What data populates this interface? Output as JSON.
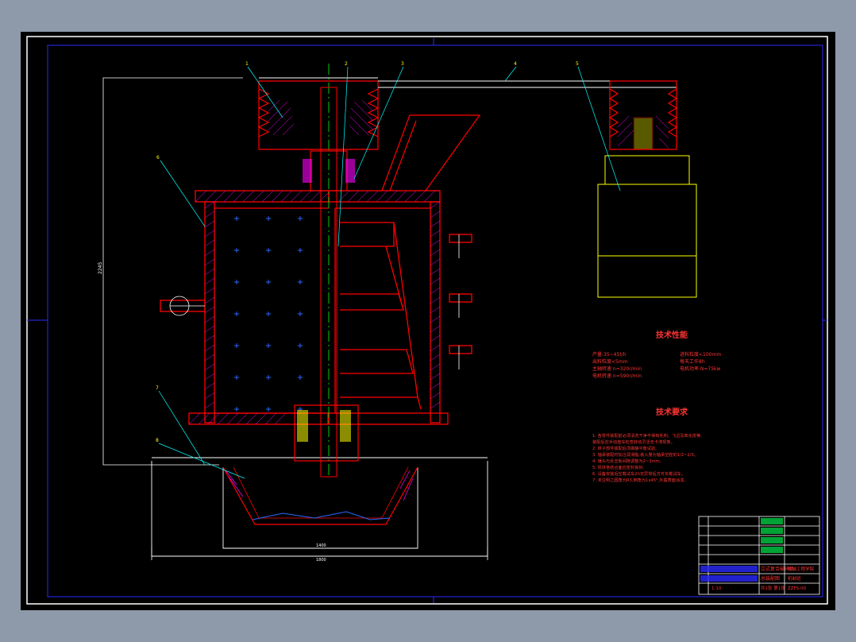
{
  "drawing": {
    "colors": {
      "background": "#000000",
      "chrome": "#8e9aaa",
      "frame": "#2a2aff",
      "outline": "#ff0000",
      "hatch": "#ff00ff",
      "centerline": "#00ff00",
      "leader": "#00ffff",
      "white": "#ffffff",
      "yellow": "#ffff00",
      "text": "#ff3333"
    }
  },
  "balloons": [
    "1",
    "2",
    "3",
    "4",
    "5",
    "6",
    "7",
    "8"
  ],
  "dimensions": {
    "overall_height": "2245",
    "base_inner_width": "1400",
    "base_width": "1800"
  },
  "tech_performance": {
    "heading": "技术性能",
    "left_items": [
      "产量:35~45t/h",
      "出料粒度<5mm",
      "主轴转速 n=320r/min",
      "电机转速 n=590r/min"
    ],
    "right_items": [
      "进料粒度<100mm",
      "每天工作8h",
      "电机功率 N=75kw"
    ]
  },
  "tech_requirements": {
    "heading": "技术要求",
    "items": [
      "1. 各零件装配前必须清洗干净不得有毛刺、飞边及氧化皮等,",
      "   装配后应手动盘车检查转动灵活无卡滞现象。",
      "2. 转子部件装配后须做静平衡试验,",
      "3. 轴承装配时加注润滑脂,装入量为轴承空腔的1/2~2/3。",
      "4. 锤头与反击板间隙调整为2~3mm,",
      "5. 机体各结合面应密封良好,",
      "6. 设备安装后空载试车2h无异常后方可负载试车。",
      "7. 未注明之圆角为R3,倒角为1x45°,外露表面涂漆。"
    ]
  },
  "title_block": {
    "drawing_name": "立式复合破碎机",
    "subtitle": "总装配图",
    "school": "机械工程学院",
    "unit": "机制班",
    "drawing_no": "ZZFS-00",
    "scale": "1:10",
    "sheet": "共1张 第1张"
  }
}
